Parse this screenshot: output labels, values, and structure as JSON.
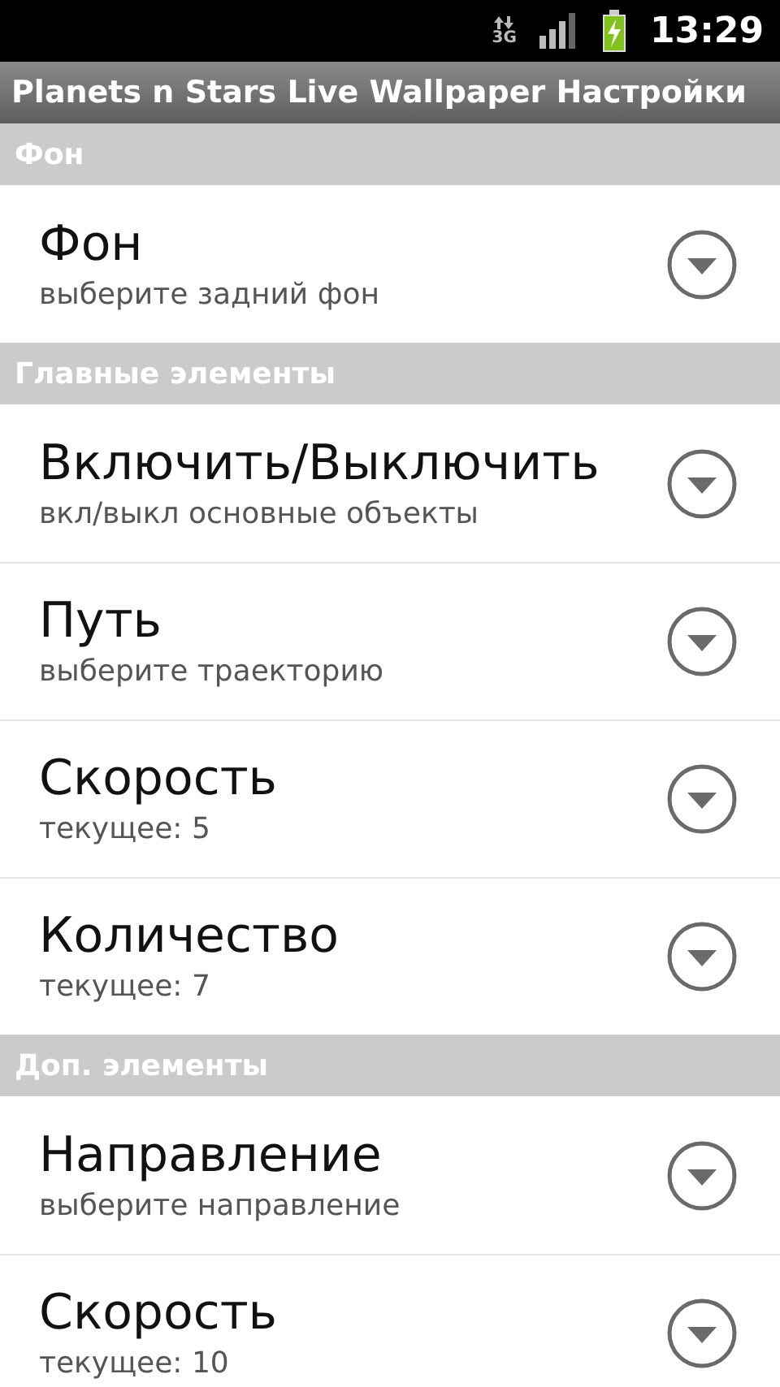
{
  "status_bar": {
    "network": "3G",
    "time": "13:29"
  },
  "window": {
    "title": "Planets n Stars Live Wallpaper Настройки"
  },
  "sections": [
    {
      "header": "Фон",
      "items": [
        {
          "title": "Фон",
          "summary": "выберите задний фон"
        }
      ]
    },
    {
      "header": "Главные элементы",
      "items": [
        {
          "title": "Включить/Выключить",
          "summary": "вкл/выкл основные объекты"
        },
        {
          "title": "Путь",
          "summary": "выберите траекторию"
        },
        {
          "title": "Скорость",
          "summary": "текущее: 5"
        },
        {
          "title": "Количество",
          "summary": "текущее: 7"
        }
      ]
    },
    {
      "header": "Доп. элементы",
      "items": [
        {
          "title": "Направление",
          "summary": "выберите направление"
        },
        {
          "title": "Скорость",
          "summary": "текущее: 10"
        }
      ]
    }
  ]
}
